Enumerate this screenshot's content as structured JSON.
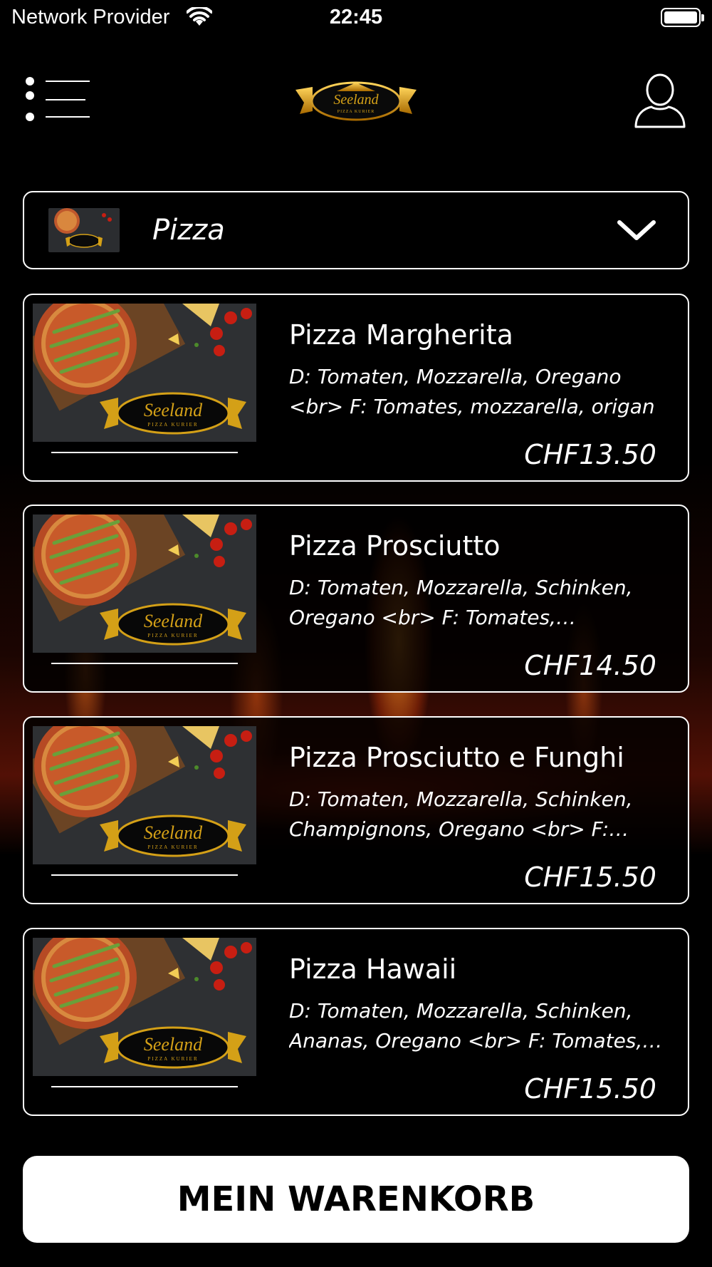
{
  "status_bar": {
    "provider": "Network Provider",
    "time": "22:45",
    "icons": [
      "wifi-icon",
      "battery-icon"
    ]
  },
  "header": {
    "menu_icon": "list-menu-icon",
    "logo_text": "Seeland",
    "logo_subtext": "PIZZA KURIER",
    "profile_icon": "user-profile-icon"
  },
  "category": {
    "selected": "Pizza",
    "icon": "chevron-down-icon"
  },
  "products": [
    {
      "name": "Pizza Margherita",
      "description": "D: Tomaten, Mozzarella, Oregano <br> F: Tomates, mozzarella, origan",
      "price": "CHF13.50"
    },
    {
      "name": "Pizza Prosciutto",
      "description": "D: Tomaten, Mozzarella, Schinken, Oregano <br> F: Tomates, mozzarella…",
      "price": "CHF14.50"
    },
    {
      "name": "Pizza Prosciutto e Funghi",
      "description": "D: Tomaten, Mozzarella, Schinken, Champignons, Oregano <br> F: Toma…",
      "price": "CHF15.50"
    },
    {
      "name": "Pizza Hawaii",
      "description": "D: Tomaten, Mozzarella, Schinken, Ananas, Oregano <br> F: Tomates, m…",
      "price": "CHF15.50"
    }
  ],
  "cart": {
    "label": "MEIN WARENKORB"
  },
  "colors": {
    "background": "#000000",
    "text": "#ffffff",
    "gold": "#d4a017",
    "cart_button_bg": "#ffffff",
    "cart_button_text": "#000000"
  }
}
